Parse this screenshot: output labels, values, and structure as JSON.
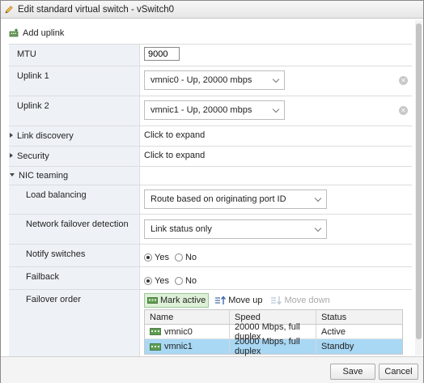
{
  "dialog": {
    "title": "Edit standard virtual switch - vSwitch0"
  },
  "toolbar": {
    "add_uplink": "Add uplink"
  },
  "mtu": {
    "label": "MTU",
    "value": "9000"
  },
  "uplink1": {
    "label": "Uplink 1",
    "value": "vmnic0 - Up, 20000 mbps"
  },
  "uplink2": {
    "label": "Uplink 2",
    "value": "vmnic1 - Up, 20000 mbps"
  },
  "link_discovery": {
    "label": "Link discovery",
    "value": "Click to expand"
  },
  "security": {
    "label": "Security",
    "value": "Click to expand"
  },
  "nic_teaming": {
    "label": "NIC teaming",
    "load_balancing": {
      "label": "Load balancing",
      "value": "Route based on originating port ID"
    },
    "failover_detection": {
      "label": "Network failover detection",
      "value": "Link status only"
    },
    "notify_switches": {
      "label": "Notify switches",
      "yes": "Yes",
      "no": "No",
      "selected": "Yes"
    },
    "failback": {
      "label": "Failback",
      "yes": "Yes",
      "no": "No",
      "selected": "Yes"
    },
    "failover_order": {
      "label": "Failover order",
      "mark_active": "Mark active",
      "move_up": "Move up",
      "move_down": "Move down",
      "columns": [
        "Name",
        "Speed",
        "Status"
      ],
      "rows": [
        {
          "name": "vmnic0",
          "speed": "20000 Mbps, full duplex",
          "status": "Active"
        },
        {
          "name": "vmnic1",
          "speed": "20000 Mbps, full duplex",
          "status": "Standby"
        }
      ]
    }
  },
  "footer": {
    "save": "Save",
    "cancel": "Cancel"
  },
  "colors": {
    "selected_row": "#a9d8f5",
    "label_cell": "#eef2f7",
    "active_button": "#dff0d8"
  }
}
